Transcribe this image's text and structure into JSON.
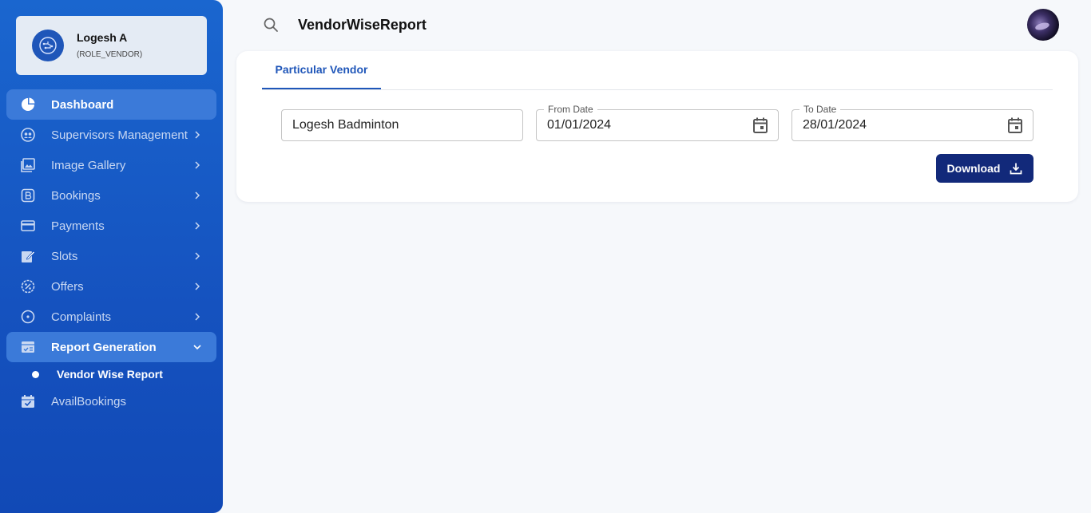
{
  "profile": {
    "name": "Logesh A",
    "role": "(ROLE_VENDOR)"
  },
  "sidebar": {
    "items": [
      {
        "label": "Dashboard",
        "icon": "pie-chart-icon",
        "active": true
      },
      {
        "label": "Supervisors Management",
        "icon": "supervisor-icon"
      },
      {
        "label": "Image Gallery",
        "icon": "gallery-icon"
      },
      {
        "label": "Bookings",
        "icon": "bookings-icon"
      },
      {
        "label": "Payments",
        "icon": "credit-card-icon"
      },
      {
        "label": "Slots",
        "icon": "edit-note-icon"
      },
      {
        "label": "Offers",
        "icon": "discount-icon"
      },
      {
        "label": "Complaints",
        "icon": "complaint-icon"
      },
      {
        "label": "Report Generation",
        "icon": "report-icon",
        "expanded": true
      },
      {
        "label": "AvailBookings",
        "icon": "calendar-check-icon"
      }
    ],
    "sub_item": "Vendor Wise Report"
  },
  "header": {
    "title": "VendorWiseReport"
  },
  "main": {
    "tab": "Particular Vendor",
    "vendor_value": "Logesh Badminton",
    "from_date_label": "From Date",
    "from_date_value": "01/01/2024",
    "to_date_label": "To Date",
    "to_date_value": "28/01/2024",
    "download_label": "Download"
  },
  "colors": {
    "sidebar": "#1a66cf",
    "active_item": "#3b7ad9",
    "primary": "#1f56b9",
    "download_button": "#12297a"
  }
}
